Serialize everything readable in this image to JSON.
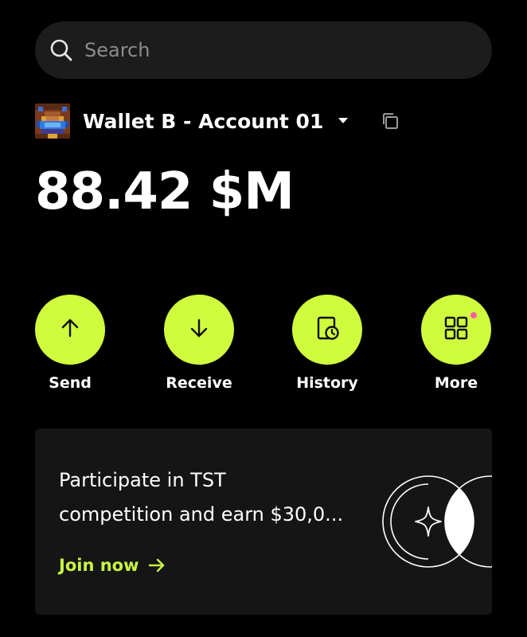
{
  "search": {
    "placeholder": "Search",
    "icon": "search-icon"
  },
  "account": {
    "name": "Wallet B - Account 01",
    "avatar_icon": "pixel-avatar",
    "dropdown_icon": "caret-down-icon",
    "copy_icon": "copy-icon"
  },
  "balance": {
    "value": "88.42 $M"
  },
  "actions": [
    {
      "label": "Send",
      "icon": "arrow-up-icon"
    },
    {
      "label": "Receive",
      "icon": "arrow-down-icon"
    },
    {
      "label": "History",
      "icon": "history-icon"
    },
    {
      "label": "More",
      "icon": "grid-icon",
      "badge": true
    }
  ],
  "promo": {
    "line1": "Participate in TST",
    "line2": "competition and earn $30,0...",
    "cta_label": "Join now",
    "cta_icon": "arrow-right-icon",
    "art_icon": "sparkle-circles-icon"
  },
  "colors": {
    "background": "#000000",
    "accent": "#d0fc3e",
    "cta": "#c8f542",
    "badge": "#ff5ca8",
    "card": "#151515",
    "search_bg": "#1c1c1c"
  }
}
